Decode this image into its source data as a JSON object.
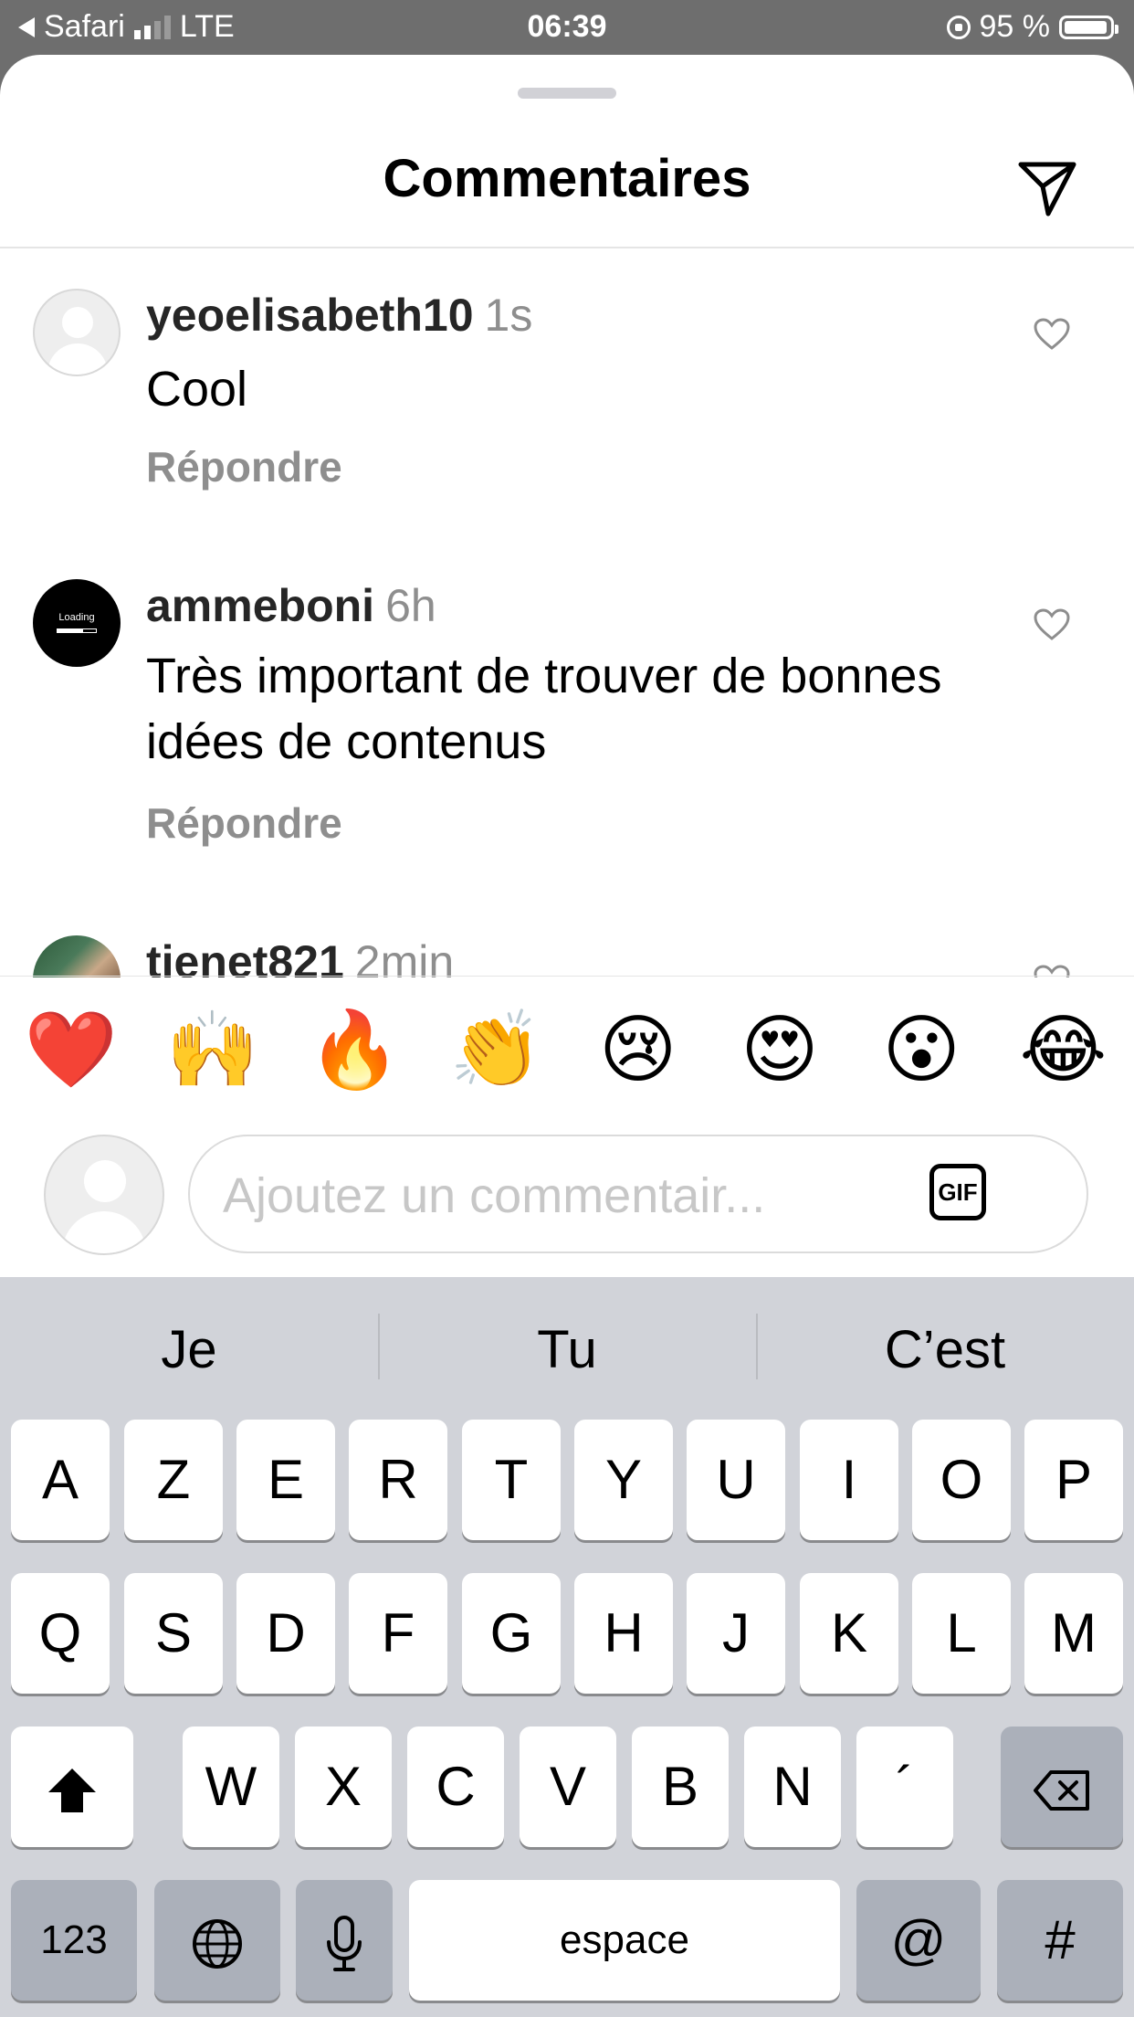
{
  "status_bar": {
    "back_app": "Safari",
    "network": "LTE",
    "time": "06:39",
    "battery": "95 %"
  },
  "header": {
    "title": "Commentaires"
  },
  "comments": [
    {
      "username": "yeoelisabeth10",
      "time": "1s",
      "text": "Cool",
      "reply": "Répondre"
    },
    {
      "username": "ammeboni",
      "time": "6h",
      "text": "Très important de trouver de bonnes idées de contenus",
      "reply": "Répondre",
      "avatar_text": "Loading"
    },
    {
      "username": "tienet821",
      "time": "2min"
    }
  ],
  "emoji_bar": [
    "❤️",
    "🙌",
    "🔥",
    "👏",
    "😢",
    "😍",
    "😮",
    "😂"
  ],
  "comment_input": {
    "placeholder": "Ajoutez un commentair...",
    "gif_label": "GIF"
  },
  "keyboard": {
    "suggestions": [
      "Je",
      "Tu",
      "C’est"
    ],
    "row1": [
      "A",
      "Z",
      "E",
      "R",
      "T",
      "Y",
      "U",
      "I",
      "O",
      "P"
    ],
    "row2": [
      "Q",
      "S",
      "D",
      "F",
      "G",
      "H",
      "J",
      "K",
      "L",
      "M"
    ],
    "row3": [
      "W",
      "X",
      "C",
      "V",
      "B",
      "N",
      "´"
    ],
    "numbers_key": "123",
    "space_key": "espace",
    "at_key": "@",
    "hash_key": "#"
  },
  "colors": {
    "status_bar_bg": "#6e6e6e",
    "secondary_text": "#8e8e8e",
    "keyboard_bg": "#d1d3d9",
    "function_key": "#abb0ba"
  }
}
